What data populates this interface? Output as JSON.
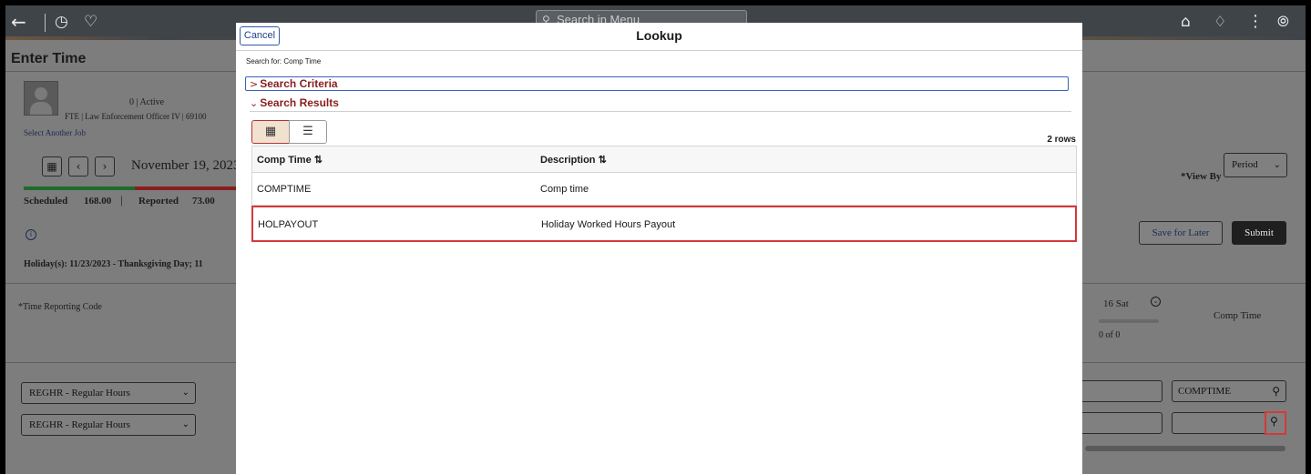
{
  "banner": {
    "back_icon": "arrow-left-icon",
    "recent_icon": "clock-icon",
    "favorites_icon": "heart-icon",
    "search_placeholder": "Search in Menu",
    "home_icon": "home-icon",
    "notifications_icon": "bell-icon",
    "actions_icon": "kebab-menu-icon",
    "navbar_icon": "compass-icon"
  },
  "background": {
    "page_title": "Enter Time",
    "employee_status": "0 | Active",
    "employee_job": "FTE | Law Enforcement Officer IV | 69100",
    "select_another_job": "Select Another Job",
    "date_label": "November 19, 2023 -",
    "scheduled_label": "Scheduled",
    "scheduled_value": "168.00",
    "reported_label": "Reported",
    "reported_value": "73.00",
    "holidays": "Holiday(s): 11/23/2023 - Thanksgiving Day; 11",
    "time_reporting_code_label": "*Time Reporting Code",
    "view_by_label": "*View By",
    "view_by_value": "Period",
    "save_for_later": "Save for Later",
    "submit": "Submit",
    "day_label": "16 Sat",
    "day_count": "0 of 0",
    "comp_time_header": "Comp Time",
    "rows": [
      {
        "trc": "REGHR - Regular Hours",
        "comp_time": "COMPTIME"
      },
      {
        "trc": "REGHR - Regular Hours",
        "comp_time": ""
      }
    ]
  },
  "modal": {
    "cancel_label": "Cancel",
    "title": "Lookup",
    "search_for": "Search for:  Comp Time",
    "search_criteria": "Search Criteria",
    "search_results": "Search Results",
    "rows_count": "2 rows",
    "columns": [
      "Comp Time ⇅",
      "Description ⇅"
    ],
    "results": [
      {
        "code": "COMPTIME",
        "description": "Comp time"
      },
      {
        "code": "HOLPAYOUT",
        "description": "Holiday Worked Hours Payout"
      }
    ]
  },
  "colors": {
    "accent_red": "#8b1d1d",
    "selection_border": "#d33a3a",
    "criteria_focus": "#3b5fbf"
  }
}
